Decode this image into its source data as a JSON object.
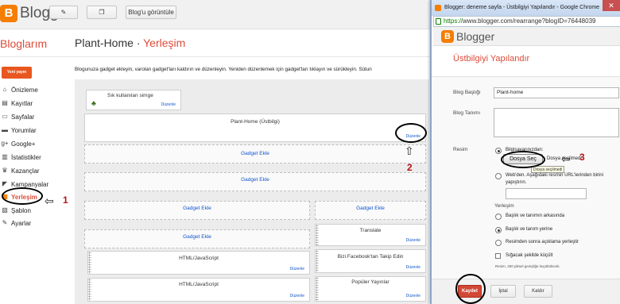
{
  "header": {
    "brand": "Blogger",
    "view_blog_label": "Blog'u görüntüle"
  },
  "blogs_bar": {
    "title": "Bloglarım",
    "blog_name": "Plant-Home",
    "separator": "·",
    "section": "Yerleşim"
  },
  "sidebar": {
    "new_post": "Yeni yayın",
    "items": [
      {
        "label": "Önizleme",
        "icon": "home-icon"
      },
      {
        "label": "Kayıtlar",
        "icon": "posts-icon"
      },
      {
        "label": "Sayfalar",
        "icon": "pages-icon"
      },
      {
        "label": "Yorumlar",
        "icon": "comments-icon"
      },
      {
        "label": "Google+",
        "icon": "google-plus-icon"
      },
      {
        "label": "İstatistikler",
        "icon": "stats-icon"
      },
      {
        "label": "Kazançlar",
        "icon": "earnings-icon"
      },
      {
        "label": "Kampanyalar",
        "icon": "campaigns-icon"
      },
      {
        "label": "Yerleşim",
        "icon": "layout-icon"
      },
      {
        "label": "Şablon",
        "icon": "template-icon"
      },
      {
        "label": "Ayarlar",
        "icon": "settings-icon"
      }
    ]
  },
  "main": {
    "description": "Blogunuza gadget ekleyin, varolan gadget'ları kaldırın ve düzenleyin. Yeniden düzenlemek için gadget'ları tıklayın ve sürükleyin. Sütun",
    "favicon_box": {
      "title": "Sık kullanılan simge",
      "edit": "Düzenle"
    },
    "header_box": {
      "title": "Plant-Home (Üstbilgi)",
      "edit": "Düzenle"
    },
    "add_gadget": "Gadget Ekle",
    "edit": "Düzenle",
    "html_js": "HTML/JavaScript",
    "translate": "Translate",
    "facebook": "Bizi Facebook'tan Takip Edin",
    "popular": "Popüler Yayınlar"
  },
  "annotations": [
    "1",
    "2",
    "3"
  ],
  "popup": {
    "window_title": "Blogger: deneme sayfa - Üstbilgiyi Yapılandır - Google Chrome",
    "url_https": "https://",
    "url_rest": "www.blogger.com/rearrange?blogID=76448039",
    "brand": "Blogger",
    "title": "Üstbilgiyi Yapılandır",
    "blog_title_label": "Blog Başlığı",
    "blog_title_value": "Plant-home",
    "blog_desc_label": "Blog Tanımı",
    "image_label": "Resim",
    "from_computer": "Bilgisayarınızdan:",
    "choose_file": "Dosya Seç",
    "no_file": "Dosya seçilmedi",
    "tooltip": "Dosya seçilmedi",
    "from_web": "Web'den. Aşağıdaki resmin URL'lerinden birini yapıştırın.",
    "placement_label": "Yerleşim",
    "opt_behind": "Başlık ve tanımın arkasında",
    "opt_instead": "Başlık ve tanım yerine",
    "opt_after": "Resimden sonra açıklama yerleştir",
    "opt_shrink": "Sığacak şekilde küçült",
    "note": "Resim, 300 piksel genişliğe küçültülecek.",
    "save": "Kaydet",
    "cancel": "İptal",
    "remove": "Kaldır"
  },
  "colors": {
    "accent_orange": "#f57d00",
    "accent_red": "#dd4b39",
    "annotation_red": "#b3161b"
  }
}
